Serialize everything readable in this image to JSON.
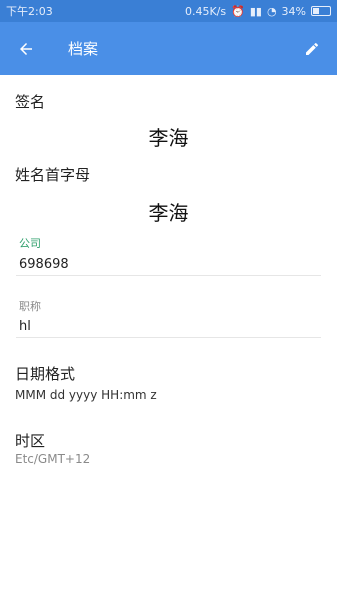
{
  "status_bar": {
    "time": "下午2:03",
    "speed": "0.45K/s",
    "battery": "34%"
  },
  "app_bar": {
    "title": "档案"
  },
  "signature": {
    "label": "签名",
    "value": "李海"
  },
  "initials": {
    "label": "姓名首字母",
    "value": "李海"
  },
  "company": {
    "label": "公司",
    "value": "698698"
  },
  "job_title": {
    "label": "职称",
    "value": "hl"
  },
  "date_format": {
    "label": "日期格式",
    "value": "MMM dd yyyy HH:mm z"
  },
  "timezone": {
    "label": "时区",
    "value": "Etc/GMT+12"
  },
  "colors": {
    "status_bar": "#3a7fd5",
    "app_bar": "#4a8fe7",
    "accent_green": "#2e9f6b",
    "muted": "#8a8a8a"
  }
}
